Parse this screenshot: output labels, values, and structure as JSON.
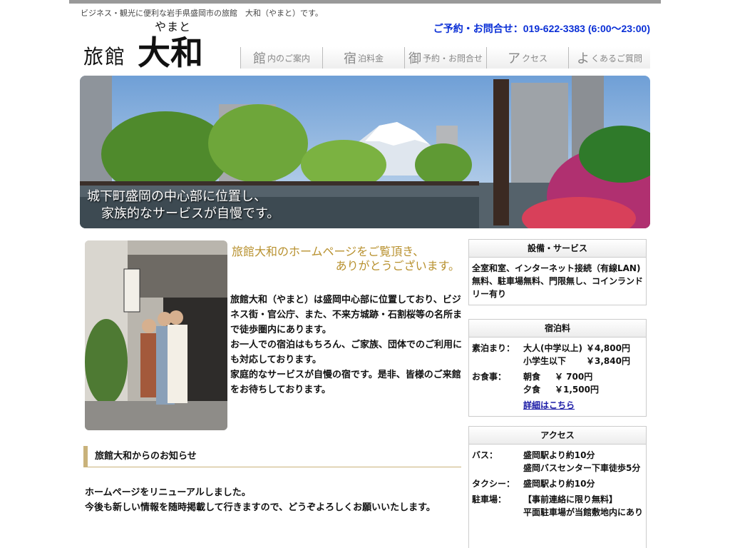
{
  "header": {
    "tagline": "ビジネス・観光に便利な岩手県盛岡市の旅館　大和（やまと）です。",
    "contact": "ご予約・お問合せ：019-622-3383 (6:00〜23:00)",
    "logo_ruby": "やまと",
    "logo_small": "旅館",
    "logo_big": "大和"
  },
  "nav": [
    {
      "lead": "館",
      "label": "内のご案内"
    },
    {
      "lead": "宿",
      "label": "泊料金"
    },
    {
      "lead": "御",
      "label": "予約・お問合せ"
    },
    {
      "lead": "ア",
      "label": "クセス"
    },
    {
      "lead": "よ",
      "label": "くあるご質問"
    }
  ],
  "hero": {
    "line1": "城下町盛岡の中心部に位置し、",
    "line2": "家族的なサービスが自慢です。"
  },
  "welcome": {
    "line1": "旅館大和のホームページをご覧頂き、",
    "line2": "ありがとうございます。"
  },
  "intro": {
    "p1": "旅館大和（やまと）は盛岡中心部に位置しており、ビジネス街・官公庁、また、不来方城跡・石割桜等の名所まで徒歩圏内にあります。",
    "p2": "お一人での宿泊はもちろん、ご家族、団体でのご利用にも対応しております。",
    "p3": "家庭的なサービスが自慢の宿です。是非、皆様のご来館をお待ちしております。"
  },
  "news": {
    "title": "旅館大和からのお知らせ",
    "line1": "ホームページをリニューアルしました。",
    "line2": "今後も新しい情報を随時掲載して行きますので、どうぞよろしくお願いいたします。"
  },
  "services": {
    "title": "設備・サービス",
    "text": "全室和室、インターネット接続（有線LAN)無料、駐車場無料、門限無し、コインランドリー有り"
  },
  "rates": {
    "title": "宿泊料",
    "stay_label": "素泊まり：",
    "adult_label": "大人(中学以上)",
    "adult_price": "￥4,800円",
    "child_label": "小学生以下",
    "child_price": "￥3,840円",
    "meal_label": "お食事：",
    "breakfast_label": "朝食",
    "breakfast_price": "￥ 700円",
    "dinner_label": "夕食",
    "dinner_price": "￥1,500円",
    "details_link": "詳細はこちら"
  },
  "access": {
    "title": "アクセス",
    "bus_label": "バス：",
    "bus_line1": "盛岡駅より約10分",
    "bus_line2": "盛岡バスセンター下車徒歩5分",
    "taxi_label": "タクシー：",
    "taxi_value": "盛岡駅より約10分",
    "parking_label": "駐車場：",
    "parking_line1": "【事前連絡に限り無料】",
    "parking_line2": "平面駐車場が当館敷地内にあり"
  }
}
